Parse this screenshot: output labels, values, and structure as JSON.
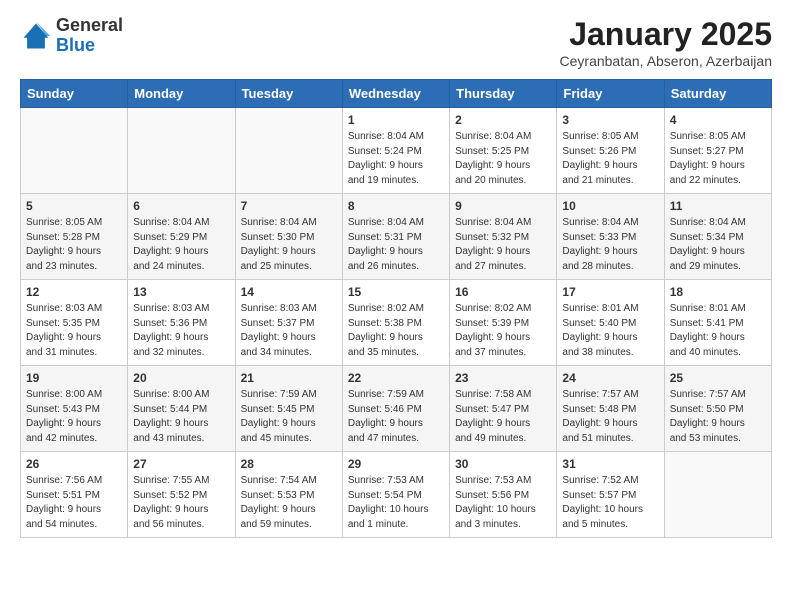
{
  "header": {
    "logo_general": "General",
    "logo_blue": "Blue",
    "month": "January 2025",
    "location": "Ceyranbatan, Abseron, Azerbaijan"
  },
  "weekdays": [
    "Sunday",
    "Monday",
    "Tuesday",
    "Wednesday",
    "Thursday",
    "Friday",
    "Saturday"
  ],
  "weeks": [
    [
      {
        "day": "",
        "info": ""
      },
      {
        "day": "",
        "info": ""
      },
      {
        "day": "",
        "info": ""
      },
      {
        "day": "1",
        "info": "Sunrise: 8:04 AM\nSunset: 5:24 PM\nDaylight: 9 hours\nand 19 minutes."
      },
      {
        "day": "2",
        "info": "Sunrise: 8:04 AM\nSunset: 5:25 PM\nDaylight: 9 hours\nand 20 minutes."
      },
      {
        "day": "3",
        "info": "Sunrise: 8:05 AM\nSunset: 5:26 PM\nDaylight: 9 hours\nand 21 minutes."
      },
      {
        "day": "4",
        "info": "Sunrise: 8:05 AM\nSunset: 5:27 PM\nDaylight: 9 hours\nand 22 minutes."
      }
    ],
    [
      {
        "day": "5",
        "info": "Sunrise: 8:05 AM\nSunset: 5:28 PM\nDaylight: 9 hours\nand 23 minutes."
      },
      {
        "day": "6",
        "info": "Sunrise: 8:04 AM\nSunset: 5:29 PM\nDaylight: 9 hours\nand 24 minutes."
      },
      {
        "day": "7",
        "info": "Sunrise: 8:04 AM\nSunset: 5:30 PM\nDaylight: 9 hours\nand 25 minutes."
      },
      {
        "day": "8",
        "info": "Sunrise: 8:04 AM\nSunset: 5:31 PM\nDaylight: 9 hours\nand 26 minutes."
      },
      {
        "day": "9",
        "info": "Sunrise: 8:04 AM\nSunset: 5:32 PM\nDaylight: 9 hours\nand 27 minutes."
      },
      {
        "day": "10",
        "info": "Sunrise: 8:04 AM\nSunset: 5:33 PM\nDaylight: 9 hours\nand 28 minutes."
      },
      {
        "day": "11",
        "info": "Sunrise: 8:04 AM\nSunset: 5:34 PM\nDaylight: 9 hours\nand 29 minutes."
      }
    ],
    [
      {
        "day": "12",
        "info": "Sunrise: 8:03 AM\nSunset: 5:35 PM\nDaylight: 9 hours\nand 31 minutes."
      },
      {
        "day": "13",
        "info": "Sunrise: 8:03 AM\nSunset: 5:36 PM\nDaylight: 9 hours\nand 32 minutes."
      },
      {
        "day": "14",
        "info": "Sunrise: 8:03 AM\nSunset: 5:37 PM\nDaylight: 9 hours\nand 34 minutes."
      },
      {
        "day": "15",
        "info": "Sunrise: 8:02 AM\nSunset: 5:38 PM\nDaylight: 9 hours\nand 35 minutes."
      },
      {
        "day": "16",
        "info": "Sunrise: 8:02 AM\nSunset: 5:39 PM\nDaylight: 9 hours\nand 37 minutes."
      },
      {
        "day": "17",
        "info": "Sunrise: 8:01 AM\nSunset: 5:40 PM\nDaylight: 9 hours\nand 38 minutes."
      },
      {
        "day": "18",
        "info": "Sunrise: 8:01 AM\nSunset: 5:41 PM\nDaylight: 9 hours\nand 40 minutes."
      }
    ],
    [
      {
        "day": "19",
        "info": "Sunrise: 8:00 AM\nSunset: 5:43 PM\nDaylight: 9 hours\nand 42 minutes."
      },
      {
        "day": "20",
        "info": "Sunrise: 8:00 AM\nSunset: 5:44 PM\nDaylight: 9 hours\nand 43 minutes."
      },
      {
        "day": "21",
        "info": "Sunrise: 7:59 AM\nSunset: 5:45 PM\nDaylight: 9 hours\nand 45 minutes."
      },
      {
        "day": "22",
        "info": "Sunrise: 7:59 AM\nSunset: 5:46 PM\nDaylight: 9 hours\nand 47 minutes."
      },
      {
        "day": "23",
        "info": "Sunrise: 7:58 AM\nSunset: 5:47 PM\nDaylight: 9 hours\nand 49 minutes."
      },
      {
        "day": "24",
        "info": "Sunrise: 7:57 AM\nSunset: 5:48 PM\nDaylight: 9 hours\nand 51 minutes."
      },
      {
        "day": "25",
        "info": "Sunrise: 7:57 AM\nSunset: 5:50 PM\nDaylight: 9 hours\nand 53 minutes."
      }
    ],
    [
      {
        "day": "26",
        "info": "Sunrise: 7:56 AM\nSunset: 5:51 PM\nDaylight: 9 hours\nand 54 minutes."
      },
      {
        "day": "27",
        "info": "Sunrise: 7:55 AM\nSunset: 5:52 PM\nDaylight: 9 hours\nand 56 minutes."
      },
      {
        "day": "28",
        "info": "Sunrise: 7:54 AM\nSunset: 5:53 PM\nDaylight: 9 hours\nand 59 minutes."
      },
      {
        "day": "29",
        "info": "Sunrise: 7:53 AM\nSunset: 5:54 PM\nDaylight: 10 hours\nand 1 minute."
      },
      {
        "day": "30",
        "info": "Sunrise: 7:53 AM\nSunset: 5:56 PM\nDaylight: 10 hours\nand 3 minutes."
      },
      {
        "day": "31",
        "info": "Sunrise: 7:52 AM\nSunset: 5:57 PM\nDaylight: 10 hours\nand 5 minutes."
      },
      {
        "day": "",
        "info": ""
      }
    ]
  ]
}
